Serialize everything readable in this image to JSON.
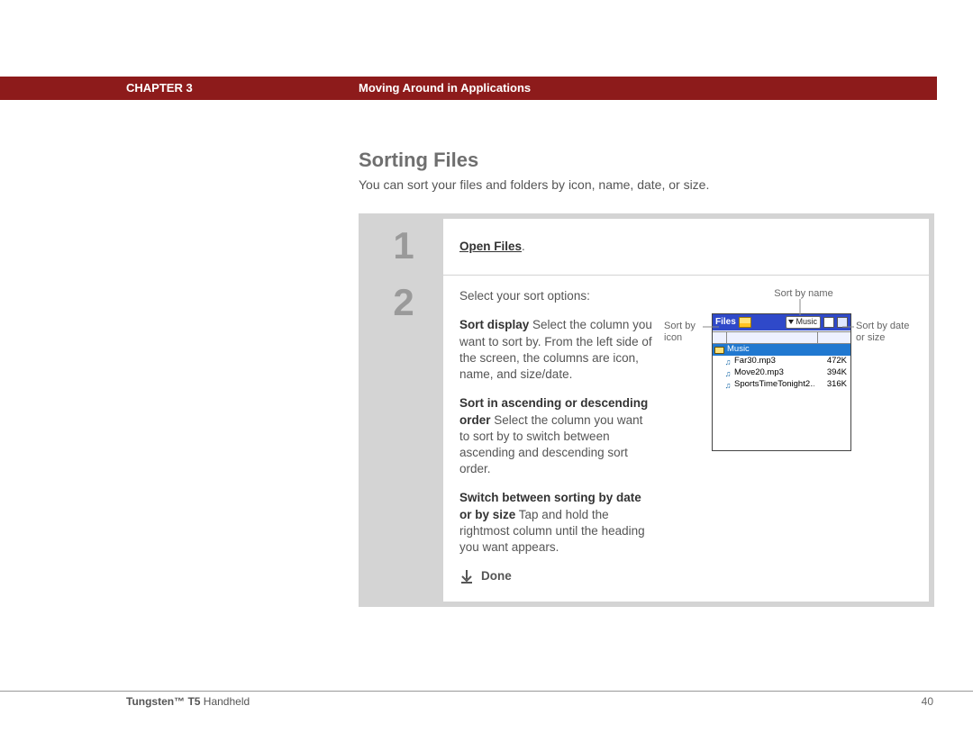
{
  "banner": {
    "chapter": "CHAPTER 3",
    "title": "Moving Around in Applications"
  },
  "section": {
    "heading": "Sorting Files",
    "lead": "You can sort your files and folders by icon, name, date, or size."
  },
  "steps": {
    "s1": {
      "num": "1",
      "link": "Open Files",
      "tail": "."
    },
    "s2": {
      "num": "2",
      "intro": "Select your sort options:",
      "p1_label": "Sort display",
      "p1_text": "   Select the column you want to sort by. From the left side of the screen, the columns are icon, name, and size/date.",
      "p2_label": "Sort in ascending or descending order",
      "p2_text": "   Select the column you want to sort by to switch between ascending and descending sort order.",
      "p3_label": "Switch between sorting by date or by size",
      "p3_text": "   Tap and hold the rightmost column until the heading you want appears.",
      "done": "Done"
    }
  },
  "callouts": {
    "top": "Sort by name",
    "left": "Sort by icon",
    "right": "Sort by date or size"
  },
  "palm": {
    "title": "Files",
    "dropdown": "Music",
    "folder": "Music",
    "files": [
      {
        "name": "Far30.mp3",
        "size": "472K"
      },
      {
        "name": "Move20.mp3",
        "size": "394K"
      },
      {
        "name": "SportsTimeTonight2…",
        "size": "316K"
      }
    ]
  },
  "footer": {
    "product_bold": "Tungsten™ T5",
    "product_rest": " Handheld",
    "page": "40"
  }
}
